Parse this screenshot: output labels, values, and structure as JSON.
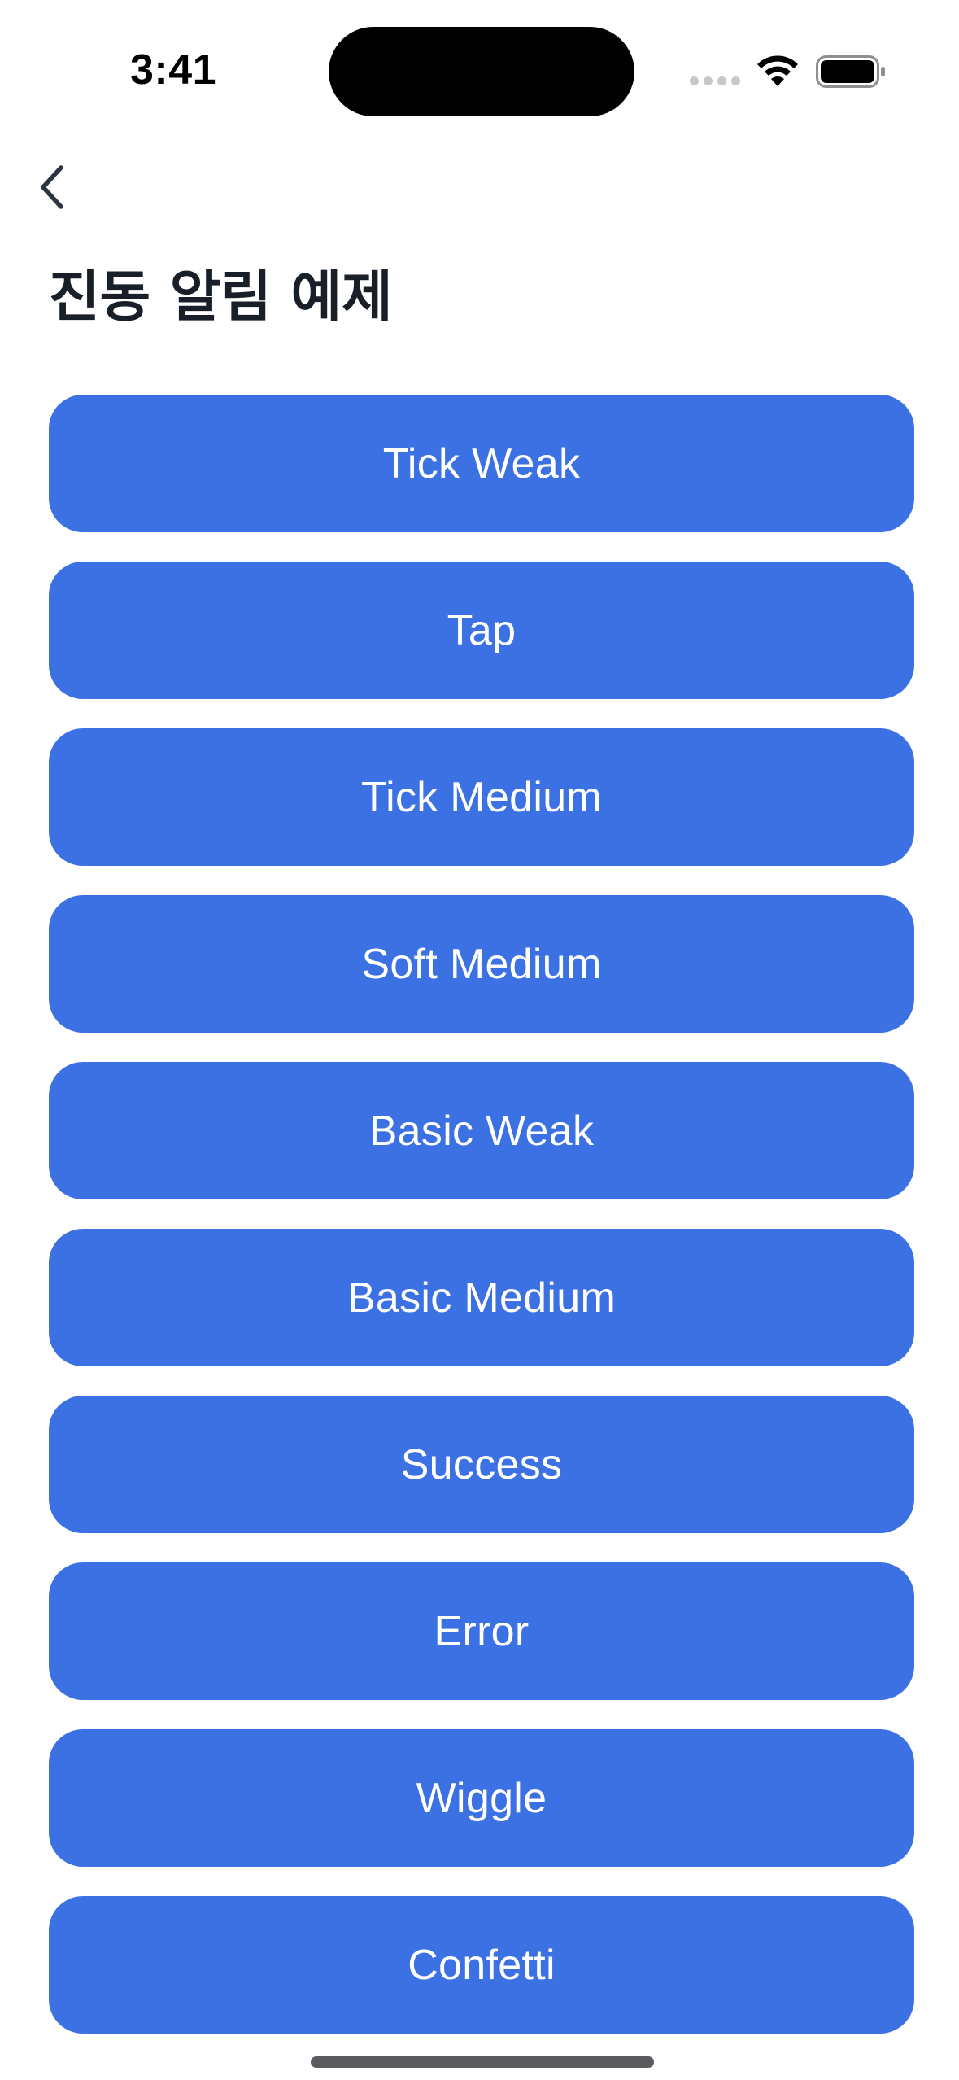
{
  "status_bar": {
    "time": "3:41",
    "icons": {
      "signal": "cellular-signal-icon",
      "wifi": "wifi-icon",
      "battery": "battery-icon"
    }
  },
  "nav": {
    "back_icon": "chevron-left-icon"
  },
  "page": {
    "title": "진동 알림 예제"
  },
  "buttons": [
    {
      "label": "Tick Weak"
    },
    {
      "label": "Tap"
    },
    {
      "label": "Tick Medium"
    },
    {
      "label": "Soft Medium"
    },
    {
      "label": "Basic Weak"
    },
    {
      "label": "Basic Medium"
    },
    {
      "label": "Success"
    },
    {
      "label": "Error"
    },
    {
      "label": "Wiggle"
    },
    {
      "label": "Confetti"
    }
  ],
  "colors": {
    "button_bg": "#3b71e2",
    "button_text": "#ffffff",
    "title_text": "#191f28",
    "background": "#ffffff"
  }
}
